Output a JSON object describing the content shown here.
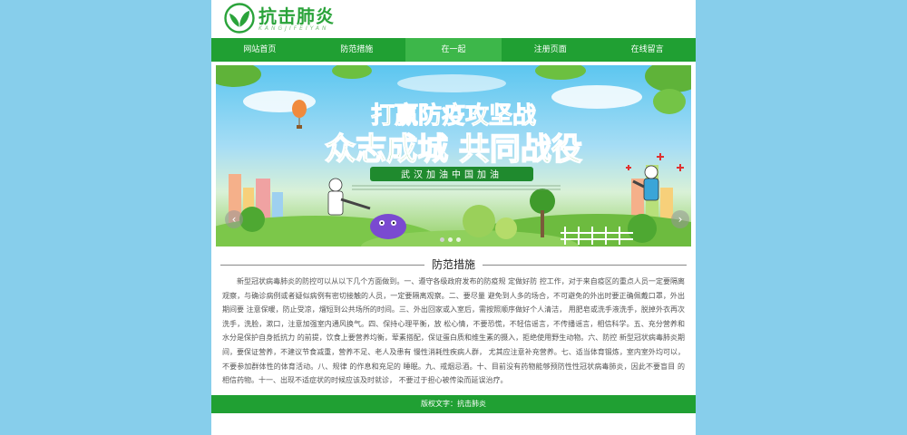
{
  "header": {
    "title": "抗击肺炎",
    "subtitle": "KANGJIFEIYAN"
  },
  "nav": {
    "items": [
      {
        "label": "网站首页"
      },
      {
        "label": "防范措施"
      },
      {
        "label": "在一起"
      },
      {
        "label": "注册页面"
      },
      {
        "label": "在线留言"
      }
    ],
    "active_index": 2
  },
  "banner": {
    "headline_1": "打赢防疫攻坚战",
    "headline_2": "众志成城 共同战役",
    "ribbon": "武汉加油中国加油",
    "prev_icon": "chevron-left-icon",
    "next_icon": "chevron-right-icon",
    "slide_count": 3,
    "active_slide": 0
  },
  "section": {
    "title": "防范措施",
    "body": "新型冠状病毒肺炎的防控可以从以下几个方面做到。一、遵守各级政府发布的防疫规 定做好防 控工作，对于来自疫区的重点人员一定要隔离观察，与确诊病例或者疑似病例有密切接触的人员，一定要隔离观察。二、要尽量 避免到人多的场合，不可避免的外出时要正确佩戴口罩，外出期间要 注意保暖，防止受凉，熘短到公共场所的时间。三、外出回家或入室后，需按照顺序做好个人清洁， 用肥皂或洗手液洗手，脱掉外衣再次洗手，洗脸，漱口，注意加强室内通风换气。四、保持心理平衡，放 松心情，不要恐慌，不轻信谣言，不传播谣言，相信科学。五、充分营养和水分是保护自身抵抗力 的前提，饮食上要营养均衡，荤素搭配，保证蛋白质和维生素的摄入，拒绝使用野生动物。六、防控 新型冠状病毒肺炎期间，要保证营养，不建议节食减重，营养不足、老人及患有 慢性消耗性疾病人群， 尤其应注意补充营养。七、适当体育锻炼，室内室外均可以，不要参加群体性的体育活动。八、规律 的作息和充足的 睡眠。九、戒烟忌酒。十、目前没有药物能够预防性性冠状病毒肺炎，因此不要盲目 的相信药物。十一、出现不适症状的时候应该及时就诊， 不要过于担心被传染而延误治疗。"
  },
  "footer": {
    "text": "版权文字：抗击肺炎"
  },
  "colors": {
    "page_bg": "#87ceeb",
    "brand_green": "#20a033",
    "nav_active": "#3db74a",
    "title_green": "#2aa33a"
  }
}
